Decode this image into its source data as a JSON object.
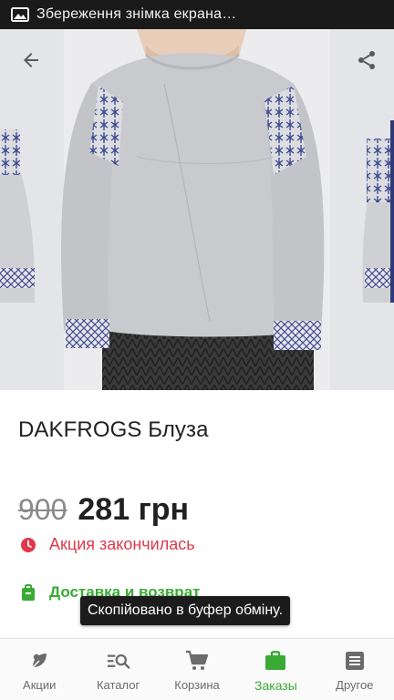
{
  "status_bar": {
    "notification_text": "Збереження знімка екрана…"
  },
  "product": {
    "title": "DAKFROGS Блуза",
    "old_price": "900",
    "new_price": "281 грн",
    "promo_status": "Акция закончилась",
    "delivery_link": "Доставка и возврат"
  },
  "toast": {
    "message": "Скопійовано в буфер обміну."
  },
  "bottom_nav": {
    "items": [
      {
        "label": "Акции",
        "icon": "leaf-icon"
      },
      {
        "label": "Каталог",
        "icon": "catalog-search-icon"
      },
      {
        "label": "Корзина",
        "icon": "cart-icon"
      },
      {
        "label": "Заказы",
        "icon": "briefcase-icon",
        "active": true
      },
      {
        "label": "Другое",
        "icon": "menu-list-icon"
      }
    ]
  },
  "colors": {
    "accent_green": "#3aaa35",
    "promo_red": "#e0394a",
    "status_bar": "#1a1a1a"
  }
}
